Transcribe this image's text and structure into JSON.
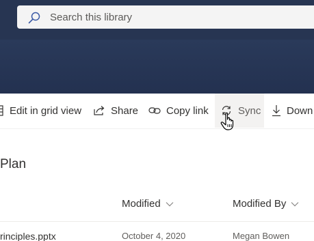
{
  "search": {
    "placeholder": "Search this library"
  },
  "toolbar": {
    "edit_grid": "Edit in grid view",
    "share": "Share",
    "copy_link": "Copy link",
    "sync": "Sync",
    "download": "Down"
  },
  "section": {
    "title": "Plan"
  },
  "columns": {
    "modified": "Modified",
    "modified_by": "Modified By"
  },
  "rows": [
    {
      "name": "rinciples.pptx",
      "modified": "October 4, 2020",
      "modified_by": "Megan Bowen"
    }
  ],
  "colors": {
    "header": "#273552",
    "search_bg": "#f4f4f4",
    "toolbar_hover": "#f3f2f1"
  }
}
